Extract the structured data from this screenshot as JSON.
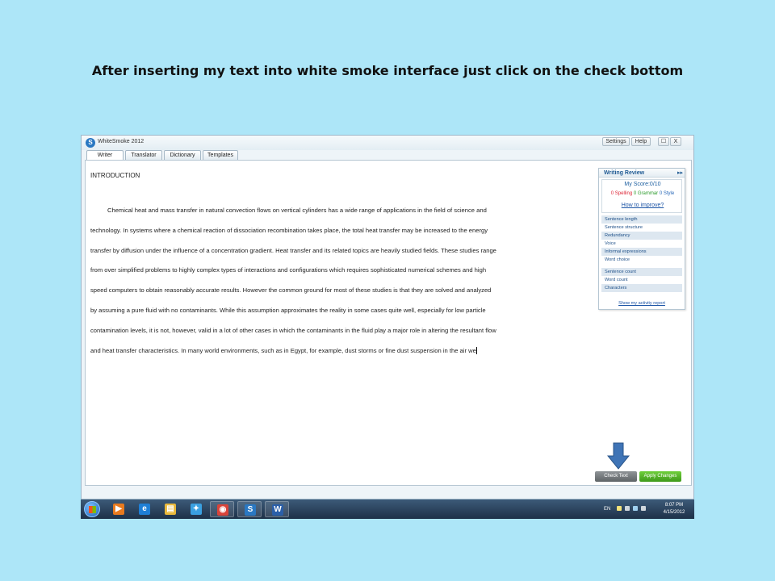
{
  "slide": {
    "title": "After inserting  my text into white smoke interface just click on the check bottom"
  },
  "window": {
    "title": "WhiteSmoke 2012",
    "settings_label": "Settings",
    "help_label": "Help",
    "minimize_label": "☐",
    "close_label": "X"
  },
  "tabs": [
    {
      "label": "Writer"
    },
    {
      "label": "Translator"
    },
    {
      "label": "Dictionary"
    },
    {
      "label": "Templates"
    }
  ],
  "editor": {
    "heading": "INTRODUCTION",
    "lines": [
      "Chemical heat and mass transfer in natural convection flows on vertical cylinders has a wide range of applications in the field of science and",
      "technology. In systems where a chemical reaction of dissociation recombination takes place, the total heat transfer may be increased to the energy",
      "transfer by diffusion under the influence of a concentration gradient. Heat transfer and its related topics are heavily studied fields. These studies range",
      "from over simplified problems to highly complex types of interactions and configurations which requires sophisticated numerical schemes and high",
      "speed computers to obtain reasonably accurate results. However the common ground for most of these studies is that they are solved and analyzed",
      "by assuming a pure fluid with no contaminants. While this assumption approximates the reality in some cases quite well, especially for low particle",
      "contamination levels, it is not, however, valid in a lot of other cases in which the contaminants in the fluid play a major role in altering the resultant flow",
      "and heat transfer characteristics. In many world environments, such as in Egypt, for example, dust storms or fine dust suspension in the air we"
    ]
  },
  "review": {
    "title": "Writing Review",
    "collapse": "▸▸",
    "score": "My Score:0/10",
    "spelling": "0 Spelling",
    "grammar": "0 Grammar",
    "style": "0 Style",
    "improve": "How to improve?",
    "items": [
      {
        "label": "Sentence length",
        "shade": true
      },
      {
        "label": "Sentence structure",
        "shade": false
      },
      {
        "label": "Redundancy",
        "shade": true
      },
      {
        "label": "Voice",
        "shade": false
      },
      {
        "label": "Informal expressions",
        "shade": true
      },
      {
        "label": "Word choice",
        "shade": false
      }
    ],
    "stats": [
      {
        "label": "Sentence count",
        "shade": true
      },
      {
        "label": "Word count",
        "shade": false
      },
      {
        "label": "Characters",
        "shade": true
      }
    ],
    "report": "Show my activity report"
  },
  "buttons": {
    "check": "Check Text",
    "apply": "Apply Changes"
  },
  "taskbar": {
    "language": "EN",
    "time": "8:07 PM",
    "date": "4/15/2012",
    "apps": [
      {
        "icon": "media-player-icon",
        "glyph": "▶",
        "color": "#e87a1e"
      },
      {
        "icon": "internet-explorer-icon",
        "glyph": "e",
        "color": "#1e7fd6"
      },
      {
        "icon": "folder-icon",
        "glyph": "▤",
        "color": "#e9b93c"
      },
      {
        "icon": "messenger-icon",
        "glyph": "✦",
        "color": "#3aa0e0"
      },
      {
        "icon": "chrome-icon",
        "glyph": "◉",
        "color": "#d9443a"
      },
      {
        "icon": "whitesmoke-icon",
        "glyph": "S",
        "color": "#2a78c2"
      },
      {
        "icon": "word-icon",
        "glyph": "W",
        "color": "#2b5fa8"
      }
    ]
  },
  "colors": {
    "background": "#ade6f8",
    "check_button": "#6f7477",
    "apply_button": "#4caf24",
    "arrow": "#3f74b6"
  }
}
